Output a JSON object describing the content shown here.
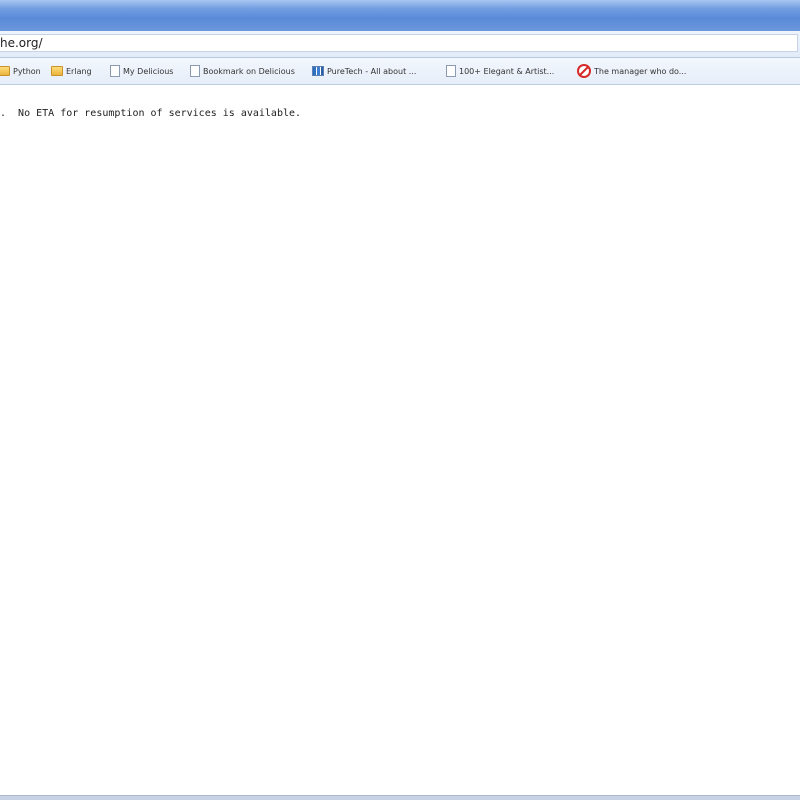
{
  "browser": {
    "address_bar": {
      "url_text": "he.org/"
    },
    "bookmarks": [
      {
        "label": "Python",
        "icon": "folder-icon"
      },
      {
        "label": "Erlang",
        "icon": "folder-icon"
      },
      {
        "label": "My Delicious",
        "icon": "page-icon"
      },
      {
        "label": "Bookmark on Delicious",
        "icon": "page-icon"
      },
      {
        "label": "PureTech - All about ...",
        "icon": "chart-icon"
      },
      {
        "label": "100+ Elegant & Artist...",
        "icon": "page-icon"
      },
      {
        "label": "The manager who do...",
        "icon": "red-circle-icon"
      }
    ]
  },
  "page": {
    "message": ".  No ETA for resumption of services is available."
  },
  "colors": {
    "titlebar": "#5a8ad8",
    "toolbar": "#e2ebf8",
    "bookmarks_bar": "#e6eef9"
  }
}
